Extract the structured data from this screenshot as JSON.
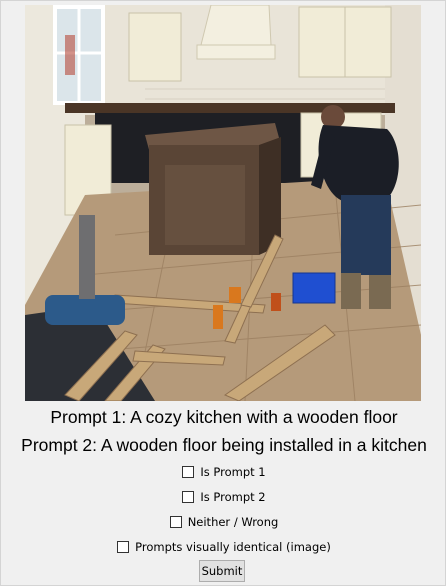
{
  "image": {
    "icon": "kitchen-photo"
  },
  "prompts": {
    "prompt1": "Prompt 1: A cozy kitchen with a wooden floor",
    "prompt2": "Prompt 2: A wooden floor being installed in a kitchen"
  },
  "options": {
    "is_prompt_1": {
      "label": "Is Prompt 1",
      "checked": false
    },
    "is_prompt_2": {
      "label": "Is Prompt 2",
      "checked": false
    },
    "neither": {
      "label": "Neither / Wrong",
      "checked": false
    },
    "identical": {
      "label": "Prompts visually identical (image)",
      "checked": false
    }
  },
  "submit_label": "Submit"
}
